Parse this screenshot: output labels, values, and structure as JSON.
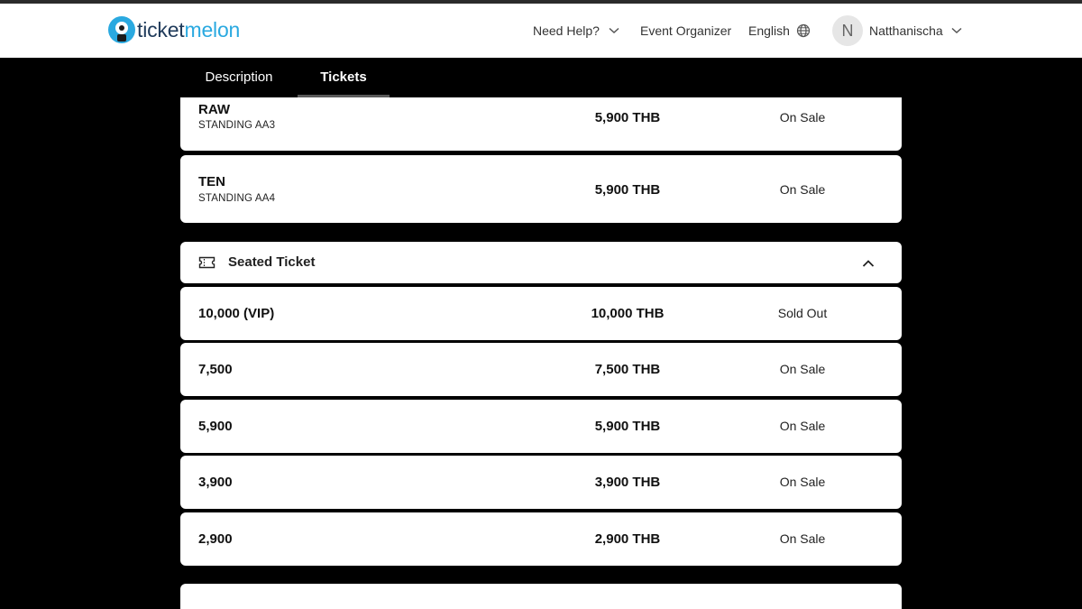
{
  "header": {
    "logo_text_dark": "ticket",
    "logo_text_blue": "melon",
    "nav": {
      "help": "Need Help?",
      "organizer": "Event Organizer",
      "language": "English",
      "user_initial": "N",
      "user_name": "Natthanischa"
    }
  },
  "tabs": [
    {
      "label": "Description",
      "active": false
    },
    {
      "label": "Tickets",
      "active": true
    }
  ],
  "standing_tickets": [
    {
      "name": "RAW",
      "zone": "STANDING AA3",
      "price": "5,900 THB",
      "status": "On Sale"
    },
    {
      "name": "TEN",
      "zone": "STANDING AA4",
      "price": "5,900 THB",
      "status": "On Sale"
    }
  ],
  "seated_section": {
    "title": "Seated Ticket",
    "tickets": [
      {
        "name": "10,000 (VIP)",
        "price": "10,000 THB",
        "status": "Sold Out"
      },
      {
        "name": "7,500",
        "price": "7,500 THB",
        "status": "On Sale"
      },
      {
        "name": "5,900",
        "price": "5,900 THB",
        "status": "On Sale"
      },
      {
        "name": "3,900",
        "price": "3,900 THB",
        "status": "On Sale"
      },
      {
        "name": "2,900",
        "price": "2,900 THB",
        "status": "On Sale"
      }
    ]
  },
  "colors": {
    "brand_blue": "#2aa9e0",
    "brand_dark": "#1f3a5a",
    "page_bg": "#000000"
  },
  "icons": [
    "chevron-down-icon",
    "globe-icon",
    "ticket-icon",
    "chevron-up-icon"
  ]
}
